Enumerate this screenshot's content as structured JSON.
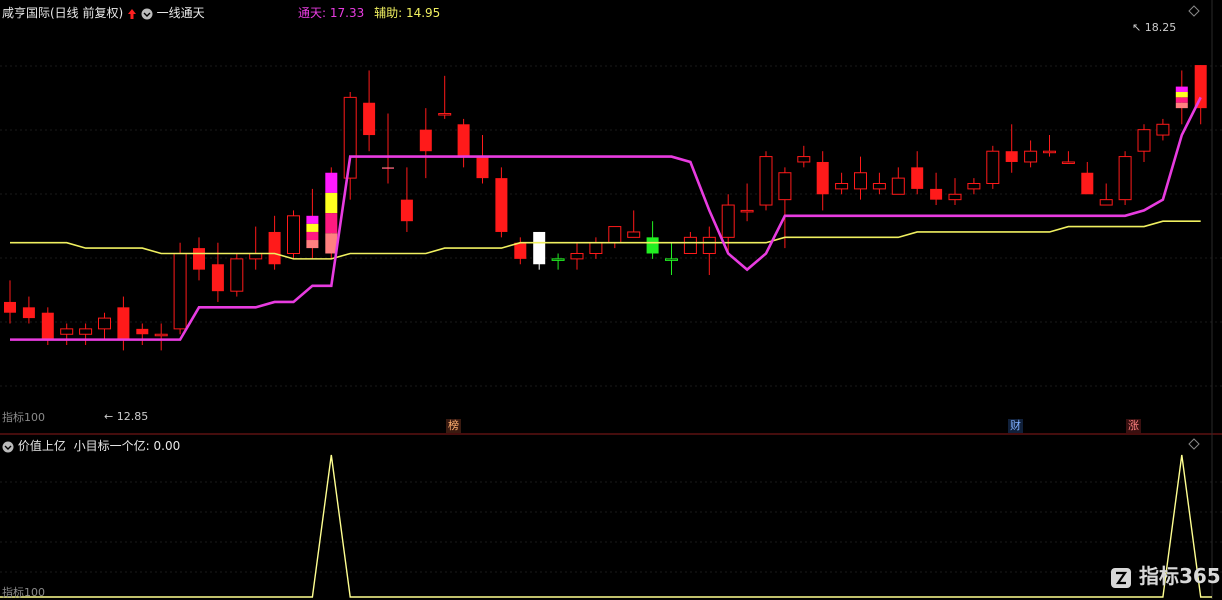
{
  "header": {
    "title": "咸亨国际(日线 前复权)",
    "indicator_name": "一线通天",
    "tongtian_label": "通天:",
    "tongtian_value": "17.33",
    "fuzhu_label": "辅助:",
    "fuzhu_value": "14.95"
  },
  "price_panel": {
    "high_label": "18.25",
    "low_label": "12.85",
    "corner_label": "指标100",
    "price_min": 11.6,
    "price_max": 18.9,
    "candles": [
      [
        13.7,
        14.1,
        13.3,
        13.5
      ],
      [
        13.6,
        13.8,
        13.3,
        13.4
      ],
      [
        13.5,
        13.6,
        12.9,
        13.0
      ],
      [
        13.1,
        13.3,
        12.9,
        13.2
      ],
      [
        13.1,
        13.3,
        12.9,
        13.2
      ],
      [
        13.2,
        13.5,
        13.0,
        13.4
      ],
      [
        13.6,
        13.8,
        12.8,
        13.0
      ],
      [
        13.2,
        13.3,
        12.9,
        13.1
      ],
      [
        13.1,
        13.3,
        12.8,
        13.1
      ],
      [
        13.2,
        14.8,
        13.1,
        14.6
      ],
      [
        14.7,
        14.9,
        14.1,
        14.3
      ],
      [
        14.4,
        14.8,
        13.7,
        13.9
      ],
      [
        13.9,
        14.6,
        13.8,
        14.5
      ],
      [
        14.5,
        15.1,
        14.3,
        14.6
      ],
      [
        15.0,
        15.3,
        14.3,
        14.4
      ],
      [
        14.6,
        15.4,
        14.5,
        15.3
      ],
      [
        15.3,
        15.8,
        14.5,
        14.7
      ],
      [
        14.6,
        16.2,
        14.5,
        16.1
      ],
      [
        16.0,
        17.6,
        15.6,
        17.5
      ],
      [
        17.4,
        18.0,
        16.5,
        16.8
      ],
      [
        16.2,
        17.2,
        15.9,
        16.2
      ],
      [
        15.6,
        16.2,
        15.0,
        15.2
      ],
      [
        16.9,
        17.3,
        16.0,
        16.5
      ],
      [
        17.2,
        17.9,
        17.1,
        17.2
      ],
      [
        17.0,
        17.1,
        16.2,
        16.4
      ],
      [
        16.4,
        16.8,
        15.9,
        16.0
      ],
      [
        16.0,
        16.2,
        14.9,
        15.0
      ],
      [
        14.8,
        14.9,
        14.4,
        14.5
      ],
      [
        14.4,
        15.0,
        14.3,
        15.0
      ],
      [
        14.5,
        14.6,
        14.3,
        14.5
      ],
      [
        14.5,
        14.8,
        14.3,
        14.6
      ],
      [
        14.6,
        14.9,
        14.5,
        14.8
      ],
      [
        14.8,
        15.1,
        14.7,
        15.1
      ],
      [
        14.9,
        15.4,
        14.9,
        15.0
      ],
      [
        14.9,
        15.2,
        14.5,
        14.6
      ],
      [
        14.5,
        14.8,
        14.2,
        14.5
      ],
      [
        14.6,
        15.0,
        14.6,
        14.9
      ],
      [
        14.6,
        15.1,
        14.2,
        14.9
      ],
      [
        14.9,
        15.7,
        14.6,
        15.5
      ],
      [
        15.4,
        15.9,
        15.2,
        15.4
      ],
      [
        15.5,
        16.5,
        15.4,
        16.4
      ],
      [
        15.6,
        16.2,
        14.7,
        16.1
      ],
      [
        16.3,
        16.6,
        16.2,
        16.4
      ],
      [
        16.3,
        16.5,
        15.4,
        15.7
      ],
      [
        15.8,
        16.1,
        15.7,
        15.9
      ],
      [
        15.8,
        16.4,
        15.6,
        16.1
      ],
      [
        15.8,
        16.1,
        15.7,
        15.9
      ],
      [
        15.7,
        16.2,
        15.7,
        16.0
      ],
      [
        16.2,
        16.5,
        15.7,
        15.8
      ],
      [
        15.8,
        16.1,
        15.5,
        15.6
      ],
      [
        15.6,
        16.0,
        15.5,
        15.7
      ],
      [
        15.8,
        16.0,
        15.7,
        15.9
      ],
      [
        15.9,
        16.6,
        15.8,
        16.5
      ],
      [
        16.5,
        17.0,
        16.1,
        16.3
      ],
      [
        16.3,
        16.7,
        16.2,
        16.5
      ],
      [
        16.5,
        16.8,
        16.4,
        16.5
      ],
      [
        16.3,
        16.5,
        16.3,
        16.3
      ],
      [
        16.1,
        16.3,
        16.0,
        15.7
      ],
      [
        15.5,
        15.9,
        15.5,
        15.6
      ],
      [
        15.6,
        16.5,
        15.5,
        16.4
      ],
      [
        16.5,
        17.0,
        16.3,
        16.9
      ],
      [
        16.8,
        17.1,
        16.7,
        17.0
      ],
      [
        17.3,
        18.0,
        17.0,
        17.7
      ],
      [
        18.1,
        18.1,
        17.0,
        17.3
      ]
    ],
    "tongtian_line": [
      13.0,
      13.0,
      13.0,
      13.0,
      13.0,
      13.0,
      13.0,
      13.0,
      13.0,
      13.0,
      13.6,
      13.6,
      13.6,
      13.6,
      13.7,
      13.7,
      14.0,
      14.0,
      16.4,
      16.4,
      16.4,
      16.4,
      16.4,
      16.4,
      16.4,
      16.4,
      16.4,
      16.4,
      16.4,
      16.4,
      16.4,
      16.4,
      16.4,
      16.4,
      16.4,
      16.4,
      16.3,
      15.4,
      14.6,
      14.3,
      14.6,
      15.3,
      15.3,
      15.3,
      15.3,
      15.3,
      15.3,
      15.3,
      15.3,
      15.3,
      15.3,
      15.3,
      15.3,
      15.3,
      15.3,
      15.3,
      15.3,
      15.3,
      15.3,
      15.3,
      15.4,
      15.6,
      16.8,
      17.5
    ],
    "ma_line": [
      14.8,
      14.8,
      14.8,
      14.8,
      14.7,
      14.7,
      14.7,
      14.7,
      14.6,
      14.6,
      14.6,
      14.6,
      14.6,
      14.6,
      14.6,
      14.5,
      14.5,
      14.5,
      14.6,
      14.6,
      14.6,
      14.6,
      14.6,
      14.7,
      14.7,
      14.7,
      14.7,
      14.8,
      14.8,
      14.8,
      14.8,
      14.8,
      14.8,
      14.8,
      14.8,
      14.8,
      14.8,
      14.8,
      14.8,
      14.8,
      14.8,
      14.9,
      14.9,
      14.9,
      14.9,
      14.9,
      14.9,
      14.9,
      15.0,
      15.0,
      15.0,
      15.0,
      15.0,
      15.0,
      15.0,
      15.0,
      15.1,
      15.1,
      15.1,
      15.1,
      15.1,
      15.2,
      15.2,
      15.2
    ],
    "bar_colors": {
      "up": "#ff1a1a",
      "down": "#ff1a1a",
      "green": "#22ee22",
      "white": "#ffffff",
      "tongtian": "#e83ce0",
      "ma": "#f0f060"
    },
    "signal_stacks": [
      {
        "candle": 16,
        "colors": [
          "#ff1aff",
          "#ffff20",
          "#ff1a80",
          "#ff8080"
        ]
      },
      {
        "candle": 17,
        "colors": [
          "#ff1aff",
          "#ffff20",
          "#ff1a80",
          "#ff8080"
        ]
      },
      {
        "candle": 20,
        "colors": [
          "#ff1aff",
          "#ffff20",
          "#ff1a80",
          "#ff8080"
        ]
      },
      {
        "candle": 62,
        "colors": [
          "#ff1aff",
          "#ffff20",
          "#ff1a80",
          "#ff8080"
        ]
      }
    ]
  },
  "markers": [
    {
      "text": "榜",
      "bg": "#3a1a10",
      "color": "#ffb070"
    },
    {
      "text": "财",
      "bg": "#10203a",
      "color": "#80b0ff"
    },
    {
      "text": "涨",
      "bg": "#3a1010",
      "color": "#ff8080"
    }
  ],
  "sub_panel": {
    "title": "价值上亿",
    "label": "小目标一个亿:",
    "value": "0.00",
    "corner_label": "指标100",
    "series": [
      0,
      0,
      0,
      0,
      0,
      0,
      0,
      0,
      0,
      0,
      0,
      0,
      0,
      0,
      0,
      0,
      0,
      1,
      0,
      0,
      0,
      0,
      0,
      0,
      0,
      0,
      0,
      0,
      0,
      0,
      0,
      0,
      0,
      0,
      0,
      0,
      0,
      0,
      0,
      0,
      0,
      0,
      0,
      0,
      0,
      0,
      0,
      0,
      0,
      0,
      0,
      0,
      0,
      0,
      0,
      0,
      0,
      0,
      0,
      0,
      0,
      0,
      1,
      0
    ],
    "line_color": "#ffff90"
  },
  "watermark": "指标365"
}
